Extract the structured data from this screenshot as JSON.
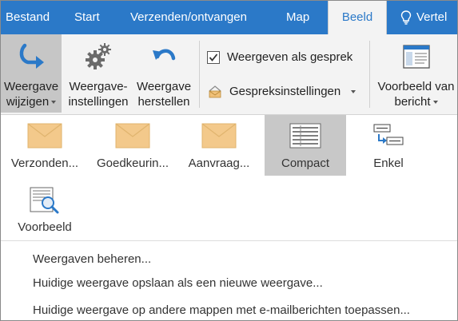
{
  "tabs": [
    {
      "label": "Bestand",
      "active": false
    },
    {
      "label": "Start",
      "active": false
    },
    {
      "label": "Verzenden/ontvangen",
      "active": false
    },
    {
      "label": "Map",
      "active": false
    },
    {
      "label": "Beeld",
      "active": true
    }
  ],
  "tell_me": {
    "label": "Vertel",
    "icon": "lightbulb-icon"
  },
  "ribbon": {
    "change_view": {
      "line1": "Weergave",
      "line2": "wijzigen",
      "icon": "change-view-arrow-icon",
      "selected": true
    },
    "view_settings": {
      "line1": "Weergave-",
      "line2": "instellingen",
      "icon": "gears-icon"
    },
    "reset_view": {
      "line1": "Weergave",
      "line2": "herstellen",
      "icon": "undo-arrow-icon"
    },
    "show_as_conversations": {
      "label": "Weergeven als gesprek",
      "checked": true
    },
    "conversation_settings": {
      "label": "Gespreksinstellingen",
      "icon": "conversation-settings-icon"
    },
    "reading_pane": {
      "line1": "Voorbeeld van",
      "line2": "bericht",
      "icon": "reading-pane-icon"
    }
  },
  "gallery": [
    {
      "label": "Verzonden...",
      "icon": "envelope-icon",
      "selected": false
    },
    {
      "label": "Goedkeurin...",
      "icon": "envelope-icon",
      "selected": false
    },
    {
      "label": "Aanvraag...",
      "icon": "envelope-icon",
      "selected": false
    },
    {
      "label": "Compact",
      "icon": "compact-list-icon",
      "selected": true
    },
    {
      "label": "Enkel",
      "icon": "single-list-icon",
      "selected": false
    },
    {
      "label": "Voorbeeld",
      "icon": "preview-magnifier-icon",
      "selected": false
    }
  ],
  "menu": {
    "manage_views": "Weergaven beheren...",
    "save_view": "Huidige weergave opslaan als een nieuwe weergave...",
    "apply_view": "Huidige weergave op andere mappen met e-mailberichten toepassen..."
  },
  "colors": {
    "accent": "#2b79c8",
    "ribbon_bg": "#f3f3f3",
    "selected_bg": "#c6c6c6",
    "envelope": "#f3c98b"
  }
}
